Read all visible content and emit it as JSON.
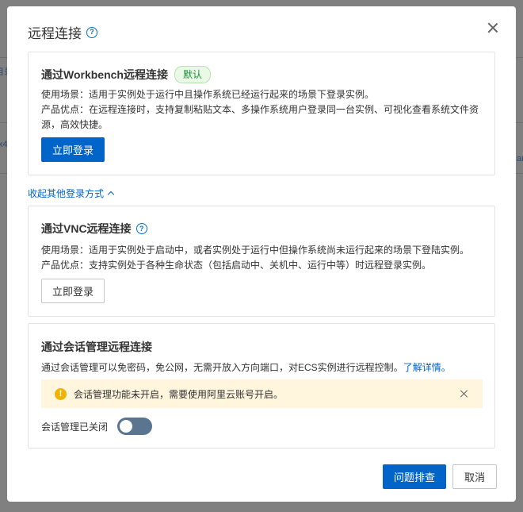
{
  "dialog": {
    "title": "远程连接",
    "close_icon": "close-icon",
    "help_icon": "question-circle-icon"
  },
  "workbench": {
    "title": "通过Workbench远程连接",
    "tag": "默认",
    "scenario": "使用场景：适用于实例处于运行中且操作系统已经运行起来的场景下登录实例。",
    "advantage": "产品优点：在远程连接时，支持复制粘贴文本、多操作系统用户登录同一台实例、可视化查看系统文件资源，高效快捷。",
    "login_label": "立即登录"
  },
  "collapse_label": "收起其他登录方式",
  "vnc": {
    "title": "通过VNC远程连接",
    "scenario": "使用场景：适用于实例处于启动中，或者实例处于运行中但操作系统尚未运行起来的场景下登陆实例。",
    "advantage": "产品优点：支持实例处于各种生命状态（包括启动中、关机中、运行中等）时远程登录实例。",
    "login_label": "立即登录"
  },
  "session": {
    "title": "通过会话管理远程连接",
    "desc": "通过会话管理可以免密码，免公网，无需开放入方向端口，对ECS实例进行远程控制。",
    "learn_more": "了解详情。",
    "alert": "会话管理功能未开启，需要使用阿里云账号开启。",
    "switch_label": "会话管理已关闭",
    "switch_on": false
  },
  "footer": {
    "troubleshoot_label": "问题排查",
    "cancel_label": "取消"
  },
  "background": {
    "frag_1": "目录",
    "frag_2": "x4",
    "frag_3": "ar"
  },
  "colors": {
    "primary": "#0064c8",
    "tag_green": "#1e8e3e",
    "warning": "#f0b400",
    "switch_off": "#5b7590"
  }
}
